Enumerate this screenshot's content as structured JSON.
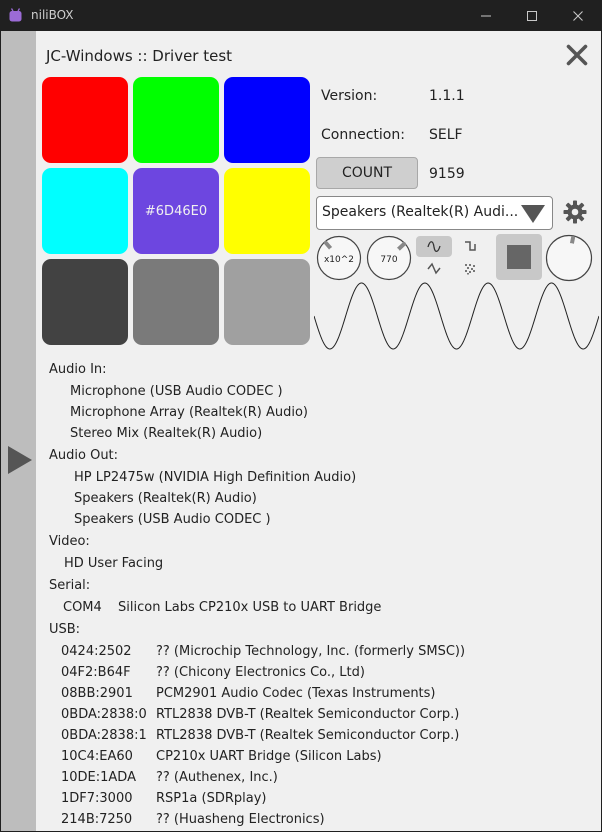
{
  "window": {
    "title": "niliBOX",
    "icon_name": "nilibox-app-icon"
  },
  "header": {
    "title": "JC-Windows :: Driver test"
  },
  "color_tiles": [
    {
      "color": "#FF0000",
      "label": ""
    },
    {
      "color": "#00FF00",
      "label": ""
    },
    {
      "color": "#0000FF",
      "label": ""
    },
    {
      "color": "#00FFFF",
      "label": ""
    },
    {
      "color": "#6D46E0",
      "label": "#6D46E0"
    },
    {
      "color": "#FFFF00",
      "label": ""
    },
    {
      "color": "#424242",
      "label": ""
    },
    {
      "color": "#7A7A7A",
      "label": ""
    },
    {
      "color": "#A0A0A0",
      "label": ""
    }
  ],
  "info": {
    "version_label": "Version:",
    "version_value": "1.1.1",
    "connection_label": "Connection:",
    "connection_value": "SELF",
    "count_button": "COUNT",
    "count_value": "9159"
  },
  "audio_device_select": {
    "selected": "Speakers (Realtek(R) Audi..."
  },
  "controls": {
    "knob_multiplier_label": "x10^2",
    "knob_frequency_label": "770",
    "waveforms": [
      "sine",
      "square",
      "triangle",
      "noise"
    ],
    "selected_waveform": "sine"
  },
  "device_list": {
    "audio_in_header": "Audio In:",
    "audio_in": [
      "Microphone (USB Audio CODEC )",
      "Microphone Array (Realtek(R) Audio)",
      "Stereo Mix (Realtek(R) Audio)"
    ],
    "audio_out_header": "Audio Out:",
    "audio_out": [
      "HP LP2475w (NVIDIA High Definition Audio)",
      "Speakers (Realtek(R) Audio)",
      "Speakers (USB Audio CODEC )"
    ],
    "video_header": "Video:",
    "video": [
      "HD User Facing"
    ],
    "serial_header": "Serial:",
    "serial": [
      {
        "port": "COM4",
        "name": "Silicon Labs CP210x USB to UART Bridge"
      }
    ],
    "usb_header": "USB:",
    "usb": [
      {
        "id": "0424:2502",
        "name": "?? (Microchip Technology, Inc. (formerly SMSC))"
      },
      {
        "id": "04F2:B64F",
        "name": "?? (Chicony Electronics Co., Ltd)"
      },
      {
        "id": "08BB:2901",
        "name": "PCM2901 Audio Codec (Texas Instruments)"
      },
      {
        "id": "0BDA:2838:0",
        "name": "RTL2838 DVB-T (Realtek Semiconductor Corp.)"
      },
      {
        "id": "0BDA:2838:1",
        "name": "RTL2838 DVB-T (Realtek Semiconductor Corp.)"
      },
      {
        "id": "10C4:EA60",
        "name": "CP210x UART Bridge (Silicon Labs)"
      },
      {
        "id": "10DE:1ADA",
        "name": "?? (Authenex, Inc.)"
      },
      {
        "id": "1DF7:3000",
        "name": "RSP1a (SDRplay)"
      },
      {
        "id": "214B:7250",
        "name": "?? (Huasheng Electronics)"
      }
    ]
  }
}
